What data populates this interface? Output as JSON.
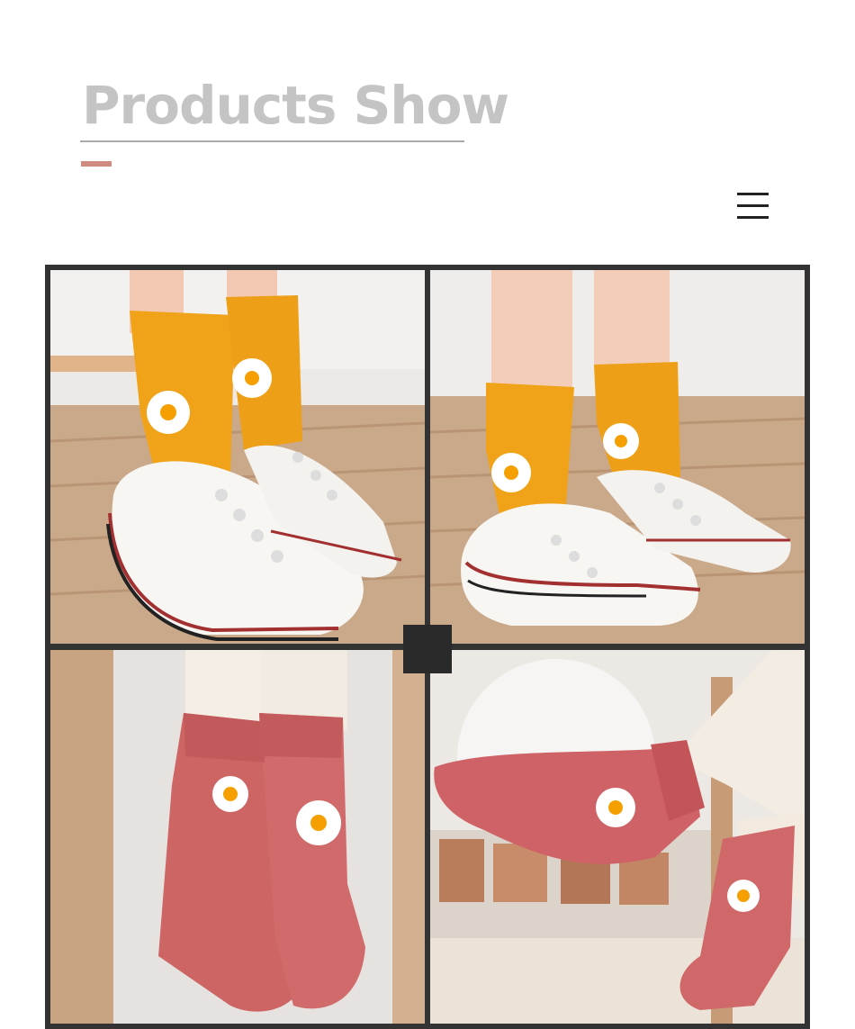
{
  "header": {
    "title": "Products Show"
  },
  "menu": {
    "icon": "hamburger-menu-icon"
  },
  "gallery": {
    "photos": [
      {
        "subject": "kids-shoes-orange-socks-1"
      },
      {
        "subject": "kids-shoes-orange-socks-2"
      },
      {
        "subject": "pink-socks-standing"
      },
      {
        "subject": "pink-socks-sitting"
      }
    ]
  },
  "colors": {
    "title": "#c4c4c4",
    "accent": "#d08a80",
    "frame": "#333333",
    "orange_sock": "#f0a318",
    "pink_sock": "#cf6266"
  }
}
